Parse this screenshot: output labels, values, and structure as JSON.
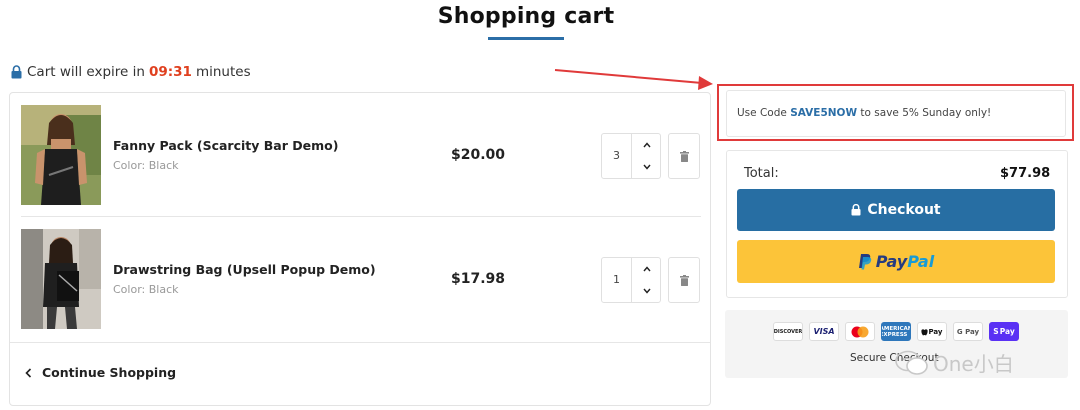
{
  "page": {
    "title": "Shopping cart"
  },
  "timer": {
    "prefix": "Cart will expire in",
    "time": "09:31",
    "suffix": "minutes"
  },
  "items": [
    {
      "name": "Fanny Pack (Scarcity Bar Demo)",
      "variant": "Color: Black",
      "price": "$20.00",
      "qty": "3"
    },
    {
      "name": "Drawstring Bag (Upsell Popup Demo)",
      "variant": "Color: Black",
      "price": "$17.98",
      "qty": "1"
    }
  ],
  "continue_label": "Continue Shopping",
  "promo": {
    "before": "Use Code",
    "code": "SAVE5NOW",
    "after": "to save 5% Sunday only!"
  },
  "summary": {
    "total_label": "Total:",
    "total_value": "$77.98",
    "checkout_label": "Checkout",
    "paypal_pay": "Pay",
    "paypal_pal": "Pal"
  },
  "payment_methods": [
    "DISCOVER",
    "VISA",
    "mastercard",
    "AMEX",
    "Apple Pay",
    "G Pay",
    "Shop Pay"
  ],
  "payment_labels": {
    "discover": "DISCOVER",
    "visa": "VISA",
    "amex": "AMERICAN EXPRESS",
    "apple": "Pay",
    "google": "G Pay",
    "shop": "Pay"
  },
  "secure_text": "Secure Checkout",
  "watermark": "One小白",
  "colors": {
    "accent": "#276ea3",
    "timer": "#e0401f",
    "paypal_bg": "#fcc439",
    "highlight_border": "#e03a3a"
  }
}
